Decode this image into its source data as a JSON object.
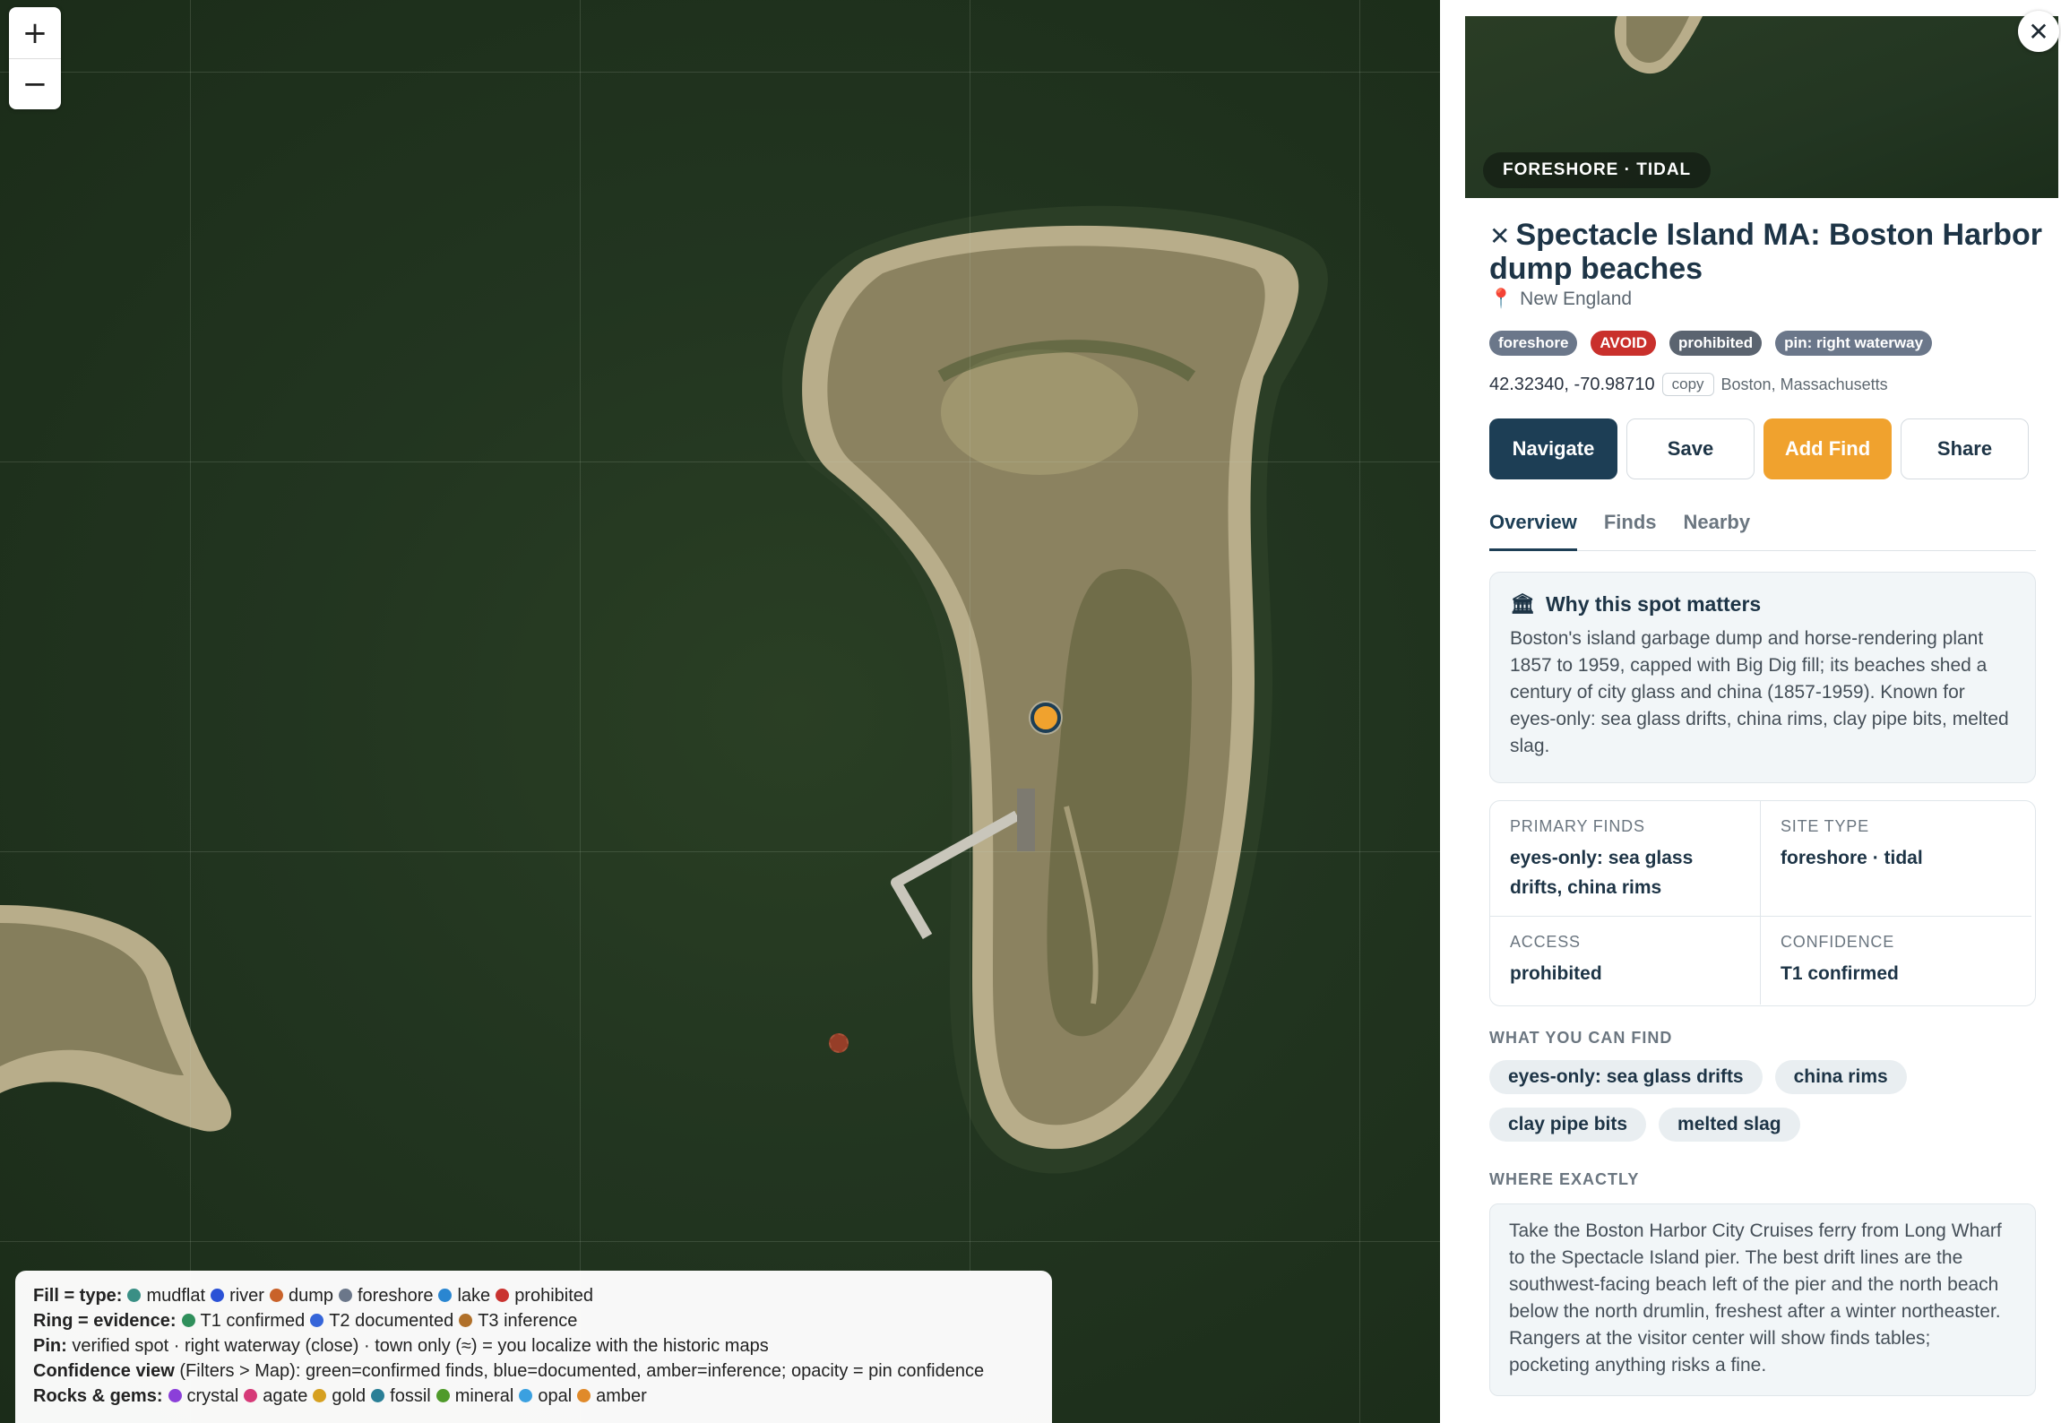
{
  "map": {
    "zoom_in_label": "+",
    "zoom_out_label": "−",
    "pin_color": "#f0a22e",
    "pin_ring_color": "#1d3e55"
  },
  "legend": {
    "fill": {
      "label": "Fill = type:",
      "items": [
        {
          "label": "mudflat",
          "color": "#3a8f85"
        },
        {
          "label": "river",
          "color": "#2b52d6"
        },
        {
          "label": "dump",
          "color": "#c9622a"
        },
        {
          "label": "foreshore",
          "color": "#6b778a"
        },
        {
          "label": "lake",
          "color": "#2a86d1"
        },
        {
          "label": "prohibited",
          "color": "#c93330"
        }
      ]
    },
    "ring": {
      "label": "Ring = evidence:",
      "items": [
        {
          "label": "T1 confirmed",
          "color": "#2f8f5b"
        },
        {
          "label": "T2 documented",
          "color": "#3565d9"
        },
        {
          "label": "T3 inference",
          "color": "#b0702a"
        }
      ]
    },
    "pin": {
      "label": "Pin:",
      "text": "verified spot · right waterway (close) · town only (≈) = you localize with the historic maps"
    },
    "confidence": {
      "label": "Confidence view",
      "text": "(Filters > Map): green=confirmed finds, blue=documented, amber=inference; opacity = pin confidence"
    },
    "rocks": {
      "label": "Rocks & gems:",
      "items": [
        {
          "label": "crystal",
          "color": "#8b3fd9"
        },
        {
          "label": "agate",
          "color": "#d63a78"
        },
        {
          "label": "gold",
          "color": "#d6a020"
        },
        {
          "label": "fossil",
          "color": "#2a7f96"
        },
        {
          "label": "mineral",
          "color": "#4f9a2a"
        },
        {
          "label": "opal",
          "color": "#3aa0e0"
        },
        {
          "label": "amber",
          "color": "#e08a2a"
        }
      ]
    }
  },
  "panel": {
    "close_label": "✕",
    "hero_badge": "FORESHORE · TIDAL",
    "title_icon": "✕",
    "title": "Spectacle Island MA: Boston Harbor dump beaches",
    "region_icon": "📍",
    "region": "New England",
    "tags": [
      {
        "label": "foreshore",
        "color": "#6b778a"
      },
      {
        "label": "AVOID",
        "color": "#c9302c"
      },
      {
        "label": "prohibited",
        "color": "#5b6470"
      },
      {
        "label": "pin: right waterway",
        "color": "#6b778a"
      }
    ],
    "coords": "42.32340, -70.98710",
    "copy_label": "copy",
    "place": "Boston, Massachusetts",
    "actions": {
      "navigate": "Navigate",
      "save": "Save",
      "add_find": "Add Find",
      "share": "Share"
    },
    "tabs": [
      "Overview",
      "Finds",
      "Nearby"
    ],
    "why": {
      "title": "Why this spot matters",
      "text": "Boston's island garbage dump and horse-rendering plant 1857 to 1959, capped with Big Dig fill; its beaches shed a century of city glass and china (1857-1959). Known for eyes-only: sea glass drifts, china rims, clay pipe bits, melted slag."
    },
    "facts": [
      {
        "label": "PRIMARY FINDS",
        "value": "eyes-only: sea glass drifts, china rims"
      },
      {
        "label": "SITE TYPE",
        "value": "foreshore · tidal"
      },
      {
        "label": "ACCESS",
        "value": "prohibited"
      },
      {
        "label": "CONFIDENCE",
        "value": "T1 confirmed"
      }
    ],
    "what_heading": "WHAT YOU CAN FIND",
    "finds": [
      "eyes-only: sea glass drifts",
      "china rims",
      "clay pipe bits",
      "melted slag"
    ],
    "where_heading": "WHERE EXACTLY",
    "where_text": "Take the Boston Harbor City Cruises ferry from Long Wharf to the Spectacle Island pier. The best drift lines are the southwest-facing beach left of the pier and the north beach below the north drumlin, freshest after a winter northeaster. Rangers at the visitor center will show finds tables; pocketing anything risks a fine."
  }
}
